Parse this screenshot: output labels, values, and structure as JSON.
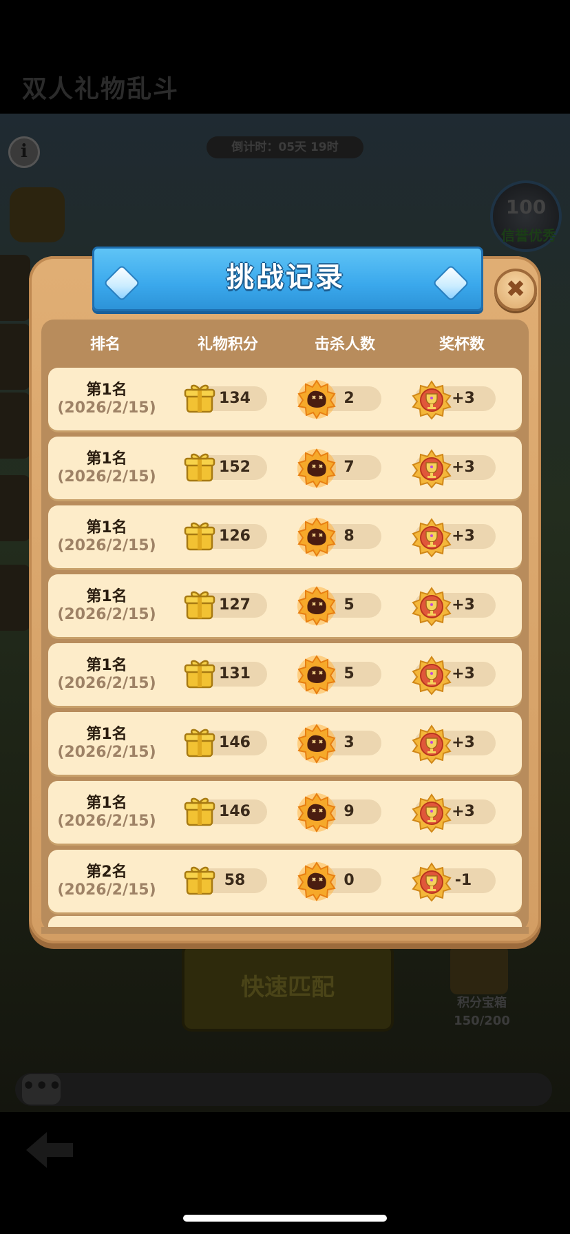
{
  "background": {
    "title": "双人礼物乱斗",
    "countdown": "倒计时：05天 19时",
    "credit_score": "100",
    "credit_label": "信誉优秀",
    "match_button": "快速匹配",
    "treasure_label": "积分宝箱",
    "treasure_progress": "150/200",
    "chat_icon": "ellipsis-icon",
    "back_icon": "back-arrow-icon"
  },
  "modal": {
    "title": "挑战记录",
    "close_icon": "close-icon",
    "columns": {
      "rank": "排名",
      "gift_points": "礼物积分",
      "kills": "击杀人数",
      "trophies": "奖杯数"
    },
    "records": [
      {
        "rank": "第1名",
        "date": "(2026/2/15)",
        "gift_points": "134",
        "kills": "2",
        "trophies": "+3"
      },
      {
        "rank": "第1名",
        "date": "(2026/2/15)",
        "gift_points": "152",
        "kills": "7",
        "trophies": "+3"
      },
      {
        "rank": "第1名",
        "date": "(2026/2/15)",
        "gift_points": "126",
        "kills": "8",
        "trophies": "+3"
      },
      {
        "rank": "第1名",
        "date": "(2026/2/15)",
        "gift_points": "127",
        "kills": "5",
        "trophies": "+3"
      },
      {
        "rank": "第1名",
        "date": "(2026/2/15)",
        "gift_points": "131",
        "kills": "5",
        "trophies": "+3"
      },
      {
        "rank": "第1名",
        "date": "(2026/2/15)",
        "gift_points": "146",
        "kills": "3",
        "trophies": "+3"
      },
      {
        "rank": "第1名",
        "date": "(2026/2/15)",
        "gift_points": "146",
        "kills": "9",
        "trophies": "+3"
      },
      {
        "rank": "第2名",
        "date": "(2026/2/15)",
        "gift_points": "58",
        "kills": "0",
        "trophies": "-1"
      }
    ]
  }
}
